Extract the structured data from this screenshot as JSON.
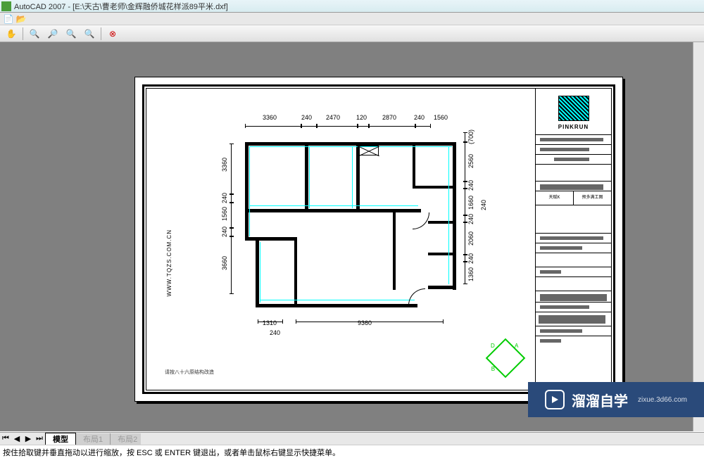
{
  "app": {
    "title": "AutoCAD 2007 - [E:\\天古\\曹老师\\金辉融侨城花样派89平米.dxf]"
  },
  "tabs": {
    "model": "模型",
    "layout1": "布局1",
    "layout2": "布局2"
  },
  "status": "按住拾取键并垂直拖动以进行缩放，按 ESC 或 ENTER 键退出，或者单击鼠标右键显示快捷菜单。",
  "dims_top": [
    "3360",
    "240",
    "2470",
    "120",
    "2870",
    "240",
    "1560"
  ],
  "dims_bottom": {
    "d1": "1310",
    "d2": "9360",
    "overall": "240"
  },
  "dims_left": [
    "3360",
    "240",
    "1560",
    "240",
    "3660"
  ],
  "dims_right": [
    "(700)",
    "2560",
    "240",
    "1660",
    "240",
    "2060",
    "240",
    "1360"
  ],
  "dims_right_outer": "240",
  "titleblock": {
    "brand": "PINKRUN"
  },
  "watermark": {
    "main": "溜溜自学",
    "sub": "zixue.3d66.com"
  },
  "url_text": "WWW.TQZS.COM.CN",
  "note_text": "请按八十六原结构改造",
  "north": {
    "A": "A",
    "D": "D",
    "B": "B"
  }
}
